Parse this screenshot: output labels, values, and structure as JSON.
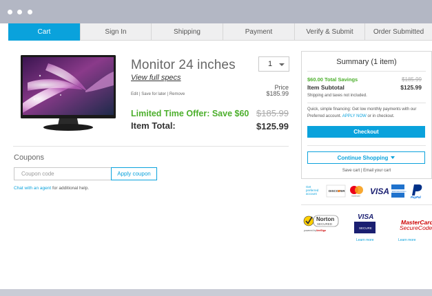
{
  "window": {
    "accent": "#0aa2dc",
    "green": "#4caf2c"
  },
  "tabs": [
    {
      "label": "Cart",
      "active": true
    },
    {
      "label": "Sign In"
    },
    {
      "label": "Shipping"
    },
    {
      "label": "Payment"
    },
    {
      "label": "Verify & Submit"
    },
    {
      "label": "Order Submitted"
    }
  ],
  "product": {
    "title": "Monitor 24 inches",
    "view_specs": "View full specs",
    "quantity": "1",
    "actions": {
      "edit": "Edit",
      "save": "Save for later",
      "remove": "Remove",
      "sep": " | "
    },
    "price_label": "Price",
    "price": "$185.99",
    "offer": "Limited Time Offer: Save $60",
    "original_price": "$185.99",
    "item_total_label": "Item Total:",
    "item_total": "$125.99"
  },
  "coupons": {
    "heading": "Coupons",
    "placeholder": "Coupon code",
    "apply_label": "Apply coupon",
    "chat_link": "Chat with an agent",
    "chat_rest": " for additional help."
  },
  "summary": {
    "title": "Summary (1 item)",
    "savings": "$60.00 Total Savings",
    "savings_strike": "$185.99",
    "subtotal_label": "Item Subtotal",
    "subtotal": "$125.99",
    "tax_note": "Shipping and taxes not included.",
    "financing_text": "Quick, simple financing: Get low monthly payments with our Preferred account. ",
    "apply_now": "APPLY NOW",
    "financing_tail": " or in checkout.",
    "checkout_label": "Checkout",
    "continue_label": "Continue Shopping",
    "save_cart": "Save cart",
    "email_cart": "Email your cart",
    "sep": " | "
  },
  "payments": {
    "preferred": [
      "Get",
      "preferred",
      "account"
    ],
    "discover": "DISCOVER",
    "mastercard_small": "mastercard",
    "visa": "VISA",
    "amex": "AMERICAN EXPRESS",
    "paypal": "PayPal"
  },
  "trust": {
    "norton": "Norton",
    "secured": "SECURED",
    "powered_by": "powered by",
    "verisign": "VeriSign",
    "visa": "VISA",
    "secure": "SECURE",
    "visa_learn": "Learn more",
    "mc_line1": "MasterCard",
    "mc_line2": "SecureCode",
    "mc_learn": "Learn more"
  }
}
